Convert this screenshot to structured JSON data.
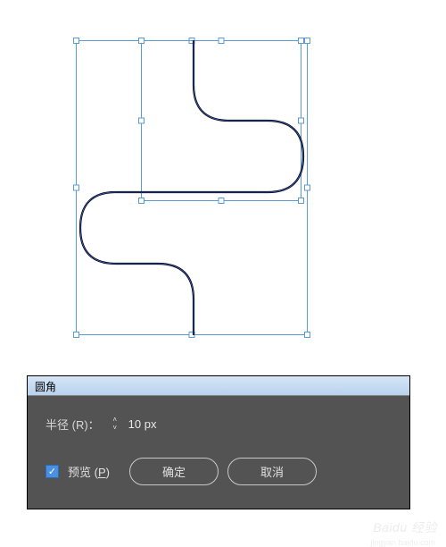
{
  "dialog": {
    "title": "圆角",
    "radius_label": "半径 (R)：",
    "radius_value": "10 px",
    "preview_label": "预览 (",
    "preview_key": "P",
    "preview_label_close": ")",
    "ok_label": "确定",
    "cancel_label": "取消"
  },
  "watermark": {
    "main": "Baidu 经验",
    "sub": "jingyan.baidu.com"
  },
  "colors": {
    "selection": "#5b9bd5",
    "dialog_bg": "#535353",
    "accent": "#4a90e2"
  },
  "icons": {
    "spin_up": "˄",
    "spin_down": "˅",
    "check": "✓"
  }
}
